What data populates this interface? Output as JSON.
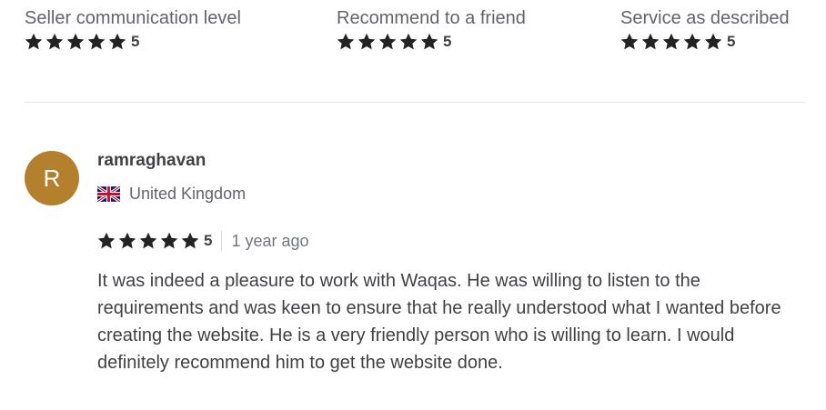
{
  "metrics": [
    {
      "label": "Seller communication level",
      "score": "5",
      "stars": 5
    },
    {
      "label": "Recommend to a friend",
      "score": "5",
      "stars": 5
    },
    {
      "label": "Service as described",
      "score": "5",
      "stars": 5
    }
  ],
  "review": {
    "avatar_letter": "R",
    "avatar_color": "#b5802c",
    "username": "ramraghavan",
    "country": "United Kingdom",
    "flag_icon": "uk-flag-icon",
    "score": "5",
    "stars": 5,
    "time_ago": "1 year ago",
    "text": "It was indeed a pleasure to work with Waqas. He was willing to listen to the requirements and was keen to ensure that he really understood what I wanted before creating the website. He is a very friendly person who is willing to learn. I would definitely recommend him to get the website done."
  },
  "colors": {
    "star": "#222325",
    "text": "#404145",
    "muted": "#62646a"
  }
}
